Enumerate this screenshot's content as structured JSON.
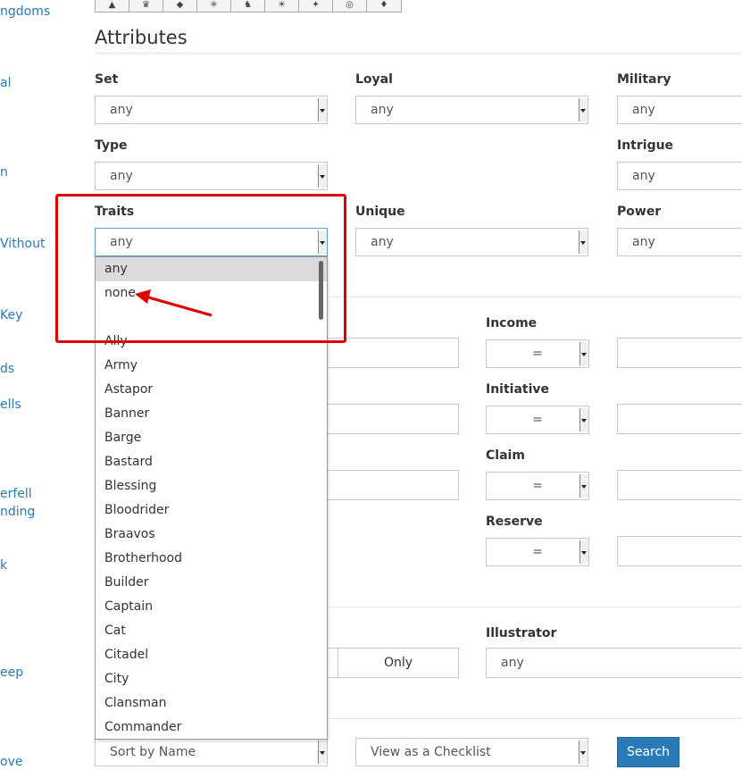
{
  "sidebar": {
    "links": [
      "ngdoms",
      "al",
      "n",
      "Vithout",
      "Key",
      "ds",
      "ells",
      "erfell",
      "nding",
      "k",
      "eep",
      "ove"
    ]
  },
  "toolbar": {
    "icons": [
      "sword-icon",
      "crown-icon",
      "leaf-icon",
      "spider-icon",
      "horse-icon",
      "sun-icon",
      "star-icon",
      "circle-icon",
      "key-icon"
    ]
  },
  "attributes": {
    "title": "Attributes",
    "set": {
      "label": "Set",
      "value": "any"
    },
    "loyal": {
      "label": "Loyal",
      "value": "any"
    },
    "military": {
      "label": "Military",
      "value": "any"
    },
    "type": {
      "label": "Type",
      "value": "any"
    },
    "intrigue": {
      "label": "Intrigue",
      "value": "any"
    },
    "traits": {
      "label": "Traits",
      "value": "any"
    },
    "unique": {
      "label": "Unique",
      "value": "any"
    },
    "power": {
      "label": "Power",
      "value": "any"
    }
  },
  "numeric": {
    "income": {
      "label": "Income",
      "operator": "="
    },
    "initiative": {
      "label": "Initiative",
      "operator": "="
    },
    "claim": {
      "label": "Claim",
      "operator": "="
    },
    "reserve": {
      "label": "Reserve",
      "operator": "="
    }
  },
  "misc": {
    "only_label": "Only",
    "illustrator": {
      "label": "Illustrator",
      "value": "any"
    }
  },
  "footer": {
    "sort": "Sort by Name",
    "view": "View as a Checklist",
    "search": "Search"
  },
  "traits_dropdown": {
    "options": [
      "any",
      "none",
      "",
      "Ally",
      "Army",
      "Astapor",
      "Banner",
      "Barge",
      "Bastard",
      "Blessing",
      "Bloodrider",
      "Braavos",
      "Brotherhood",
      "Builder",
      "Captain",
      "Cat",
      "Citadel",
      "City",
      "Clansman",
      "Commander"
    ],
    "highlighted": "any"
  },
  "annotation": {
    "box_color": "#e00000",
    "arrow_color": "#e00000"
  },
  "colors": {
    "link": "#2a7ab8",
    "primary": "#2a7ab8"
  }
}
